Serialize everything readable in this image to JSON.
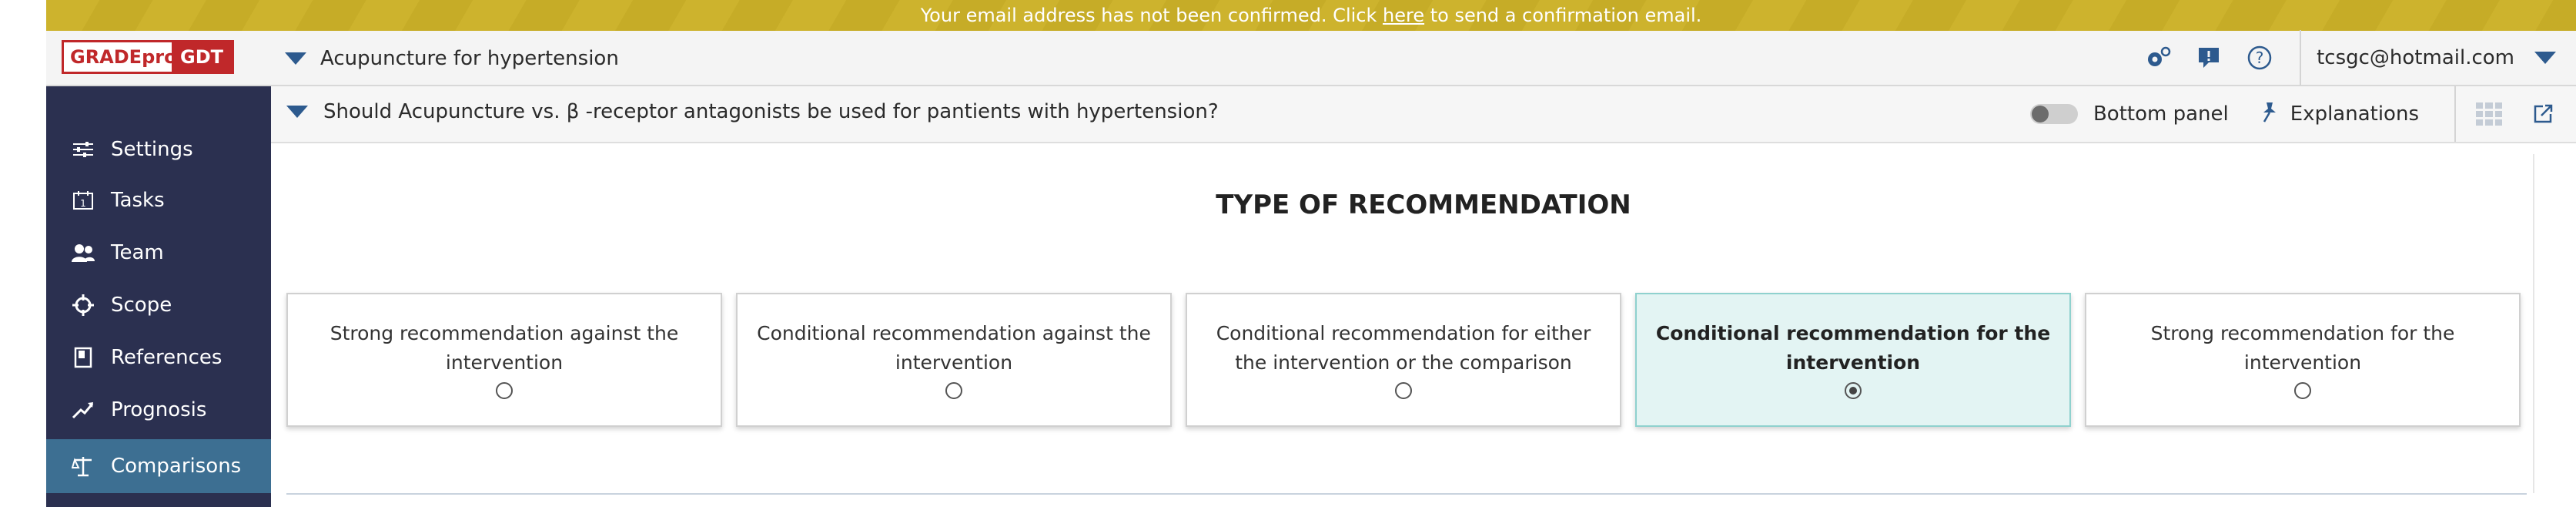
{
  "banner": {
    "text_before": "Your email address has not been confirmed. Click ",
    "link": "here",
    "text_after": " to send a confirmation email."
  },
  "header": {
    "logo_left": "GRADEpro",
    "logo_right": "GDT",
    "project_title": "Acupuncture for hypertension",
    "icons": [
      "settings-gears-icon",
      "feedback-icon",
      "help-icon"
    ],
    "user_email": "tcsgc@hotmail.com"
  },
  "sidebar": {
    "items": [
      {
        "label": "Settings",
        "icon": "sliders-icon"
      },
      {
        "label": "Tasks",
        "icon": "calendar-icon"
      },
      {
        "label": "Team",
        "icon": "team-icon"
      },
      {
        "label": "Scope",
        "icon": "scope-icon"
      },
      {
        "label": "References",
        "icon": "book-icon"
      },
      {
        "label": "Prognosis",
        "icon": "trend-icon"
      },
      {
        "label": "Comparisons",
        "icon": "scale-icon",
        "active": true
      }
    ]
  },
  "question_bar": {
    "question": "Should Acupuncture vs. β -receptor antagonists be used for pantients with hypertension?",
    "bottom_panel": "Bottom panel",
    "explanations": "Explanations"
  },
  "main": {
    "section_title": "TYPE OF RECOMMENDATION",
    "options": [
      {
        "label": "Strong recommendation against the intervention",
        "selected": false
      },
      {
        "label": "Conditional recommendation against the intervention",
        "selected": false
      },
      {
        "label": "Conditional recommendation for either the intervention or the comparison",
        "selected": false
      },
      {
        "label": "Conditional recommendation for the intervention",
        "selected": true
      },
      {
        "label": "Strong recommendation for the intervention",
        "selected": false
      }
    ]
  },
  "colors": {
    "banner": "#cdb32d",
    "sidebar": "#2b3050",
    "sidebar_active": "#3d6f92",
    "accent": "#2d5a8e",
    "selected_card": "#e3f4f3"
  }
}
